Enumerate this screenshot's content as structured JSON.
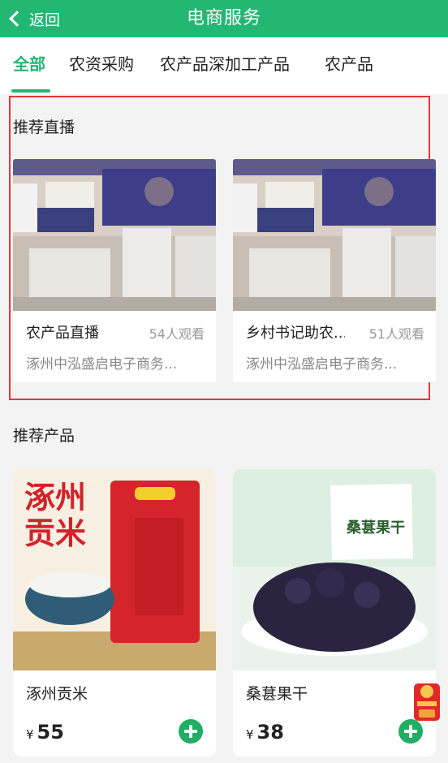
{
  "header": {
    "back_label": "返回",
    "title": "电商服务"
  },
  "tabs": [
    {
      "label": "全部",
      "active": true
    },
    {
      "label": "农资采购",
      "active": false
    },
    {
      "label": "农产品深加工产品",
      "active": false
    },
    {
      "label": "农产品",
      "active": false
    }
  ],
  "live_section": {
    "title": "推荐直播",
    "items": [
      {
        "name": "农产品直播",
        "views": "54人观看",
        "company": "涿州中泓盛启电子商务..."
      },
      {
        "name": "乡村书记助农...",
        "views": "51人观看",
        "company": "涿州中泓盛启电子商务..."
      }
    ]
  },
  "product_section": {
    "title": "推荐产品",
    "items": [
      {
        "name": "涿州贡米",
        "currency": "¥",
        "price": "55",
        "image_text": [
          "涿州",
          "贡米"
        ]
      },
      {
        "name": "桑葚果干",
        "currency": "¥",
        "price": "38",
        "image_text": "桑葚果干"
      }
    ]
  },
  "colors": {
    "brand_green": "#23b774",
    "highlight_red": "#e5363f"
  }
}
